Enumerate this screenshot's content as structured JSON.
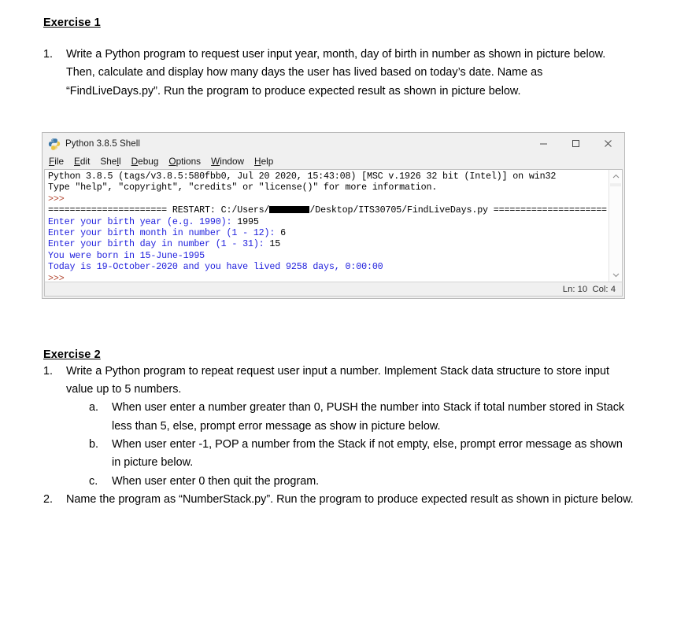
{
  "document": {
    "exercise1": {
      "heading": "Exercise 1",
      "items": [
        {
          "marker": "1.",
          "text": "Write a Python program to request user input year, month, day of birth in number as shown in picture below. Then, calculate and display how many days the user has lived based on today’s date. Name as “FindLiveDays.py”. Run the program to produce expected result as shown in picture below."
        }
      ]
    },
    "exercise2": {
      "heading": "Exercise 2",
      "items": [
        {
          "marker": "1.",
          "text": "Write a Python program to repeat request user input a number. Implement Stack data structure to store input value up to 5 numbers."
        },
        {
          "marker": "a.",
          "text": "When user enter a number greater than 0, PUSH the number into Stack if total number stored in Stack less than 5, else, prompt error message as show in picture below."
        },
        {
          "marker": "b.",
          "text": "When user enter -1, POP a number from the Stack if not empty, else, prompt error message as shown in picture below."
        },
        {
          "marker": "c.",
          "text": "When user enter 0 then quit the program."
        },
        {
          "marker": "2.",
          "text": "Name the program as “NumberStack.py”. Run the program to produce expected result as shown in picture below."
        }
      ]
    }
  },
  "shell": {
    "title": "Python 3.8.5 Shell",
    "icon": "python-logo-icon",
    "window_controls": {
      "minimize": "minimize-icon",
      "maximize": "maximize-icon",
      "close": "close-icon"
    },
    "menu": [
      {
        "mnemonic": "F",
        "rest": "ile"
      },
      {
        "mnemonic": "E",
        "rest": "dit"
      },
      {
        "pre": "She",
        "mnemonic": "l",
        "rest": "l"
      },
      {
        "mnemonic": "D",
        "rest": "ebug"
      },
      {
        "mnemonic": "O",
        "rest": "ptions"
      },
      {
        "mnemonic": "W",
        "rest": "indow"
      },
      {
        "mnemonic": "H",
        "rest": "elp"
      }
    ],
    "lines": [
      {
        "id": "l1",
        "segments": [
          {
            "color": "black",
            "text": "Python 3.8.5 (tags/v3.8.5:580fbb0, Jul 20 2020, 15:43:08) [MSC v.1926 32 bit (Intel)] on win32"
          }
        ]
      },
      {
        "id": "l2",
        "segments": [
          {
            "color": "black",
            "text": "Type \"help\", \"copyright\", \"credits\" or \"license()\" for more information."
          }
        ]
      },
      {
        "id": "l3",
        "segments": [
          {
            "color": "brown",
            "text": ">>> "
          }
        ]
      },
      {
        "id": "l4",
        "segments": [
          {
            "color": "black",
            "text": "====================== RESTART: C:/Users/"
          },
          {
            "color": "redact",
            "text": ""
          },
          {
            "color": "black",
            "text": "/Desktop/ITS30705/FindLiveDays.py ====================="
          }
        ]
      },
      {
        "id": "l5",
        "segments": [
          {
            "color": "blue",
            "text": "Enter your birth year (e.g. 1990): "
          },
          {
            "color": "black",
            "text": "1995"
          }
        ]
      },
      {
        "id": "l6",
        "segments": [
          {
            "color": "blue",
            "text": "Enter your birth month in number (1 - 12): "
          },
          {
            "color": "black",
            "text": "6"
          }
        ]
      },
      {
        "id": "l7",
        "segments": [
          {
            "color": "blue",
            "text": "Enter your birth day in number (1 - 31): "
          },
          {
            "color": "black",
            "text": "15"
          }
        ]
      },
      {
        "id": "l8",
        "segments": [
          {
            "color": "blue",
            "text": "You were born in 15-June-1995"
          }
        ]
      },
      {
        "id": "l9",
        "segments": [
          {
            "color": "blue",
            "text": "Today is 19-October-2020 and you have lived 9258 days, 0:00:00"
          }
        ]
      },
      {
        "id": "l10",
        "segments": [
          {
            "color": "brown",
            "text": ">>> "
          }
        ]
      }
    ],
    "status": "Ln: 10  Col: 4",
    "scrollbar": {
      "up": "chevron-up-icon",
      "down": "chevron-down-icon"
    }
  },
  "colors": {
    "output_blue": "#2020dd",
    "prompt_brown": "#b34a35",
    "window_chrome": "#f0f0f0",
    "redaction": "#000000"
  }
}
